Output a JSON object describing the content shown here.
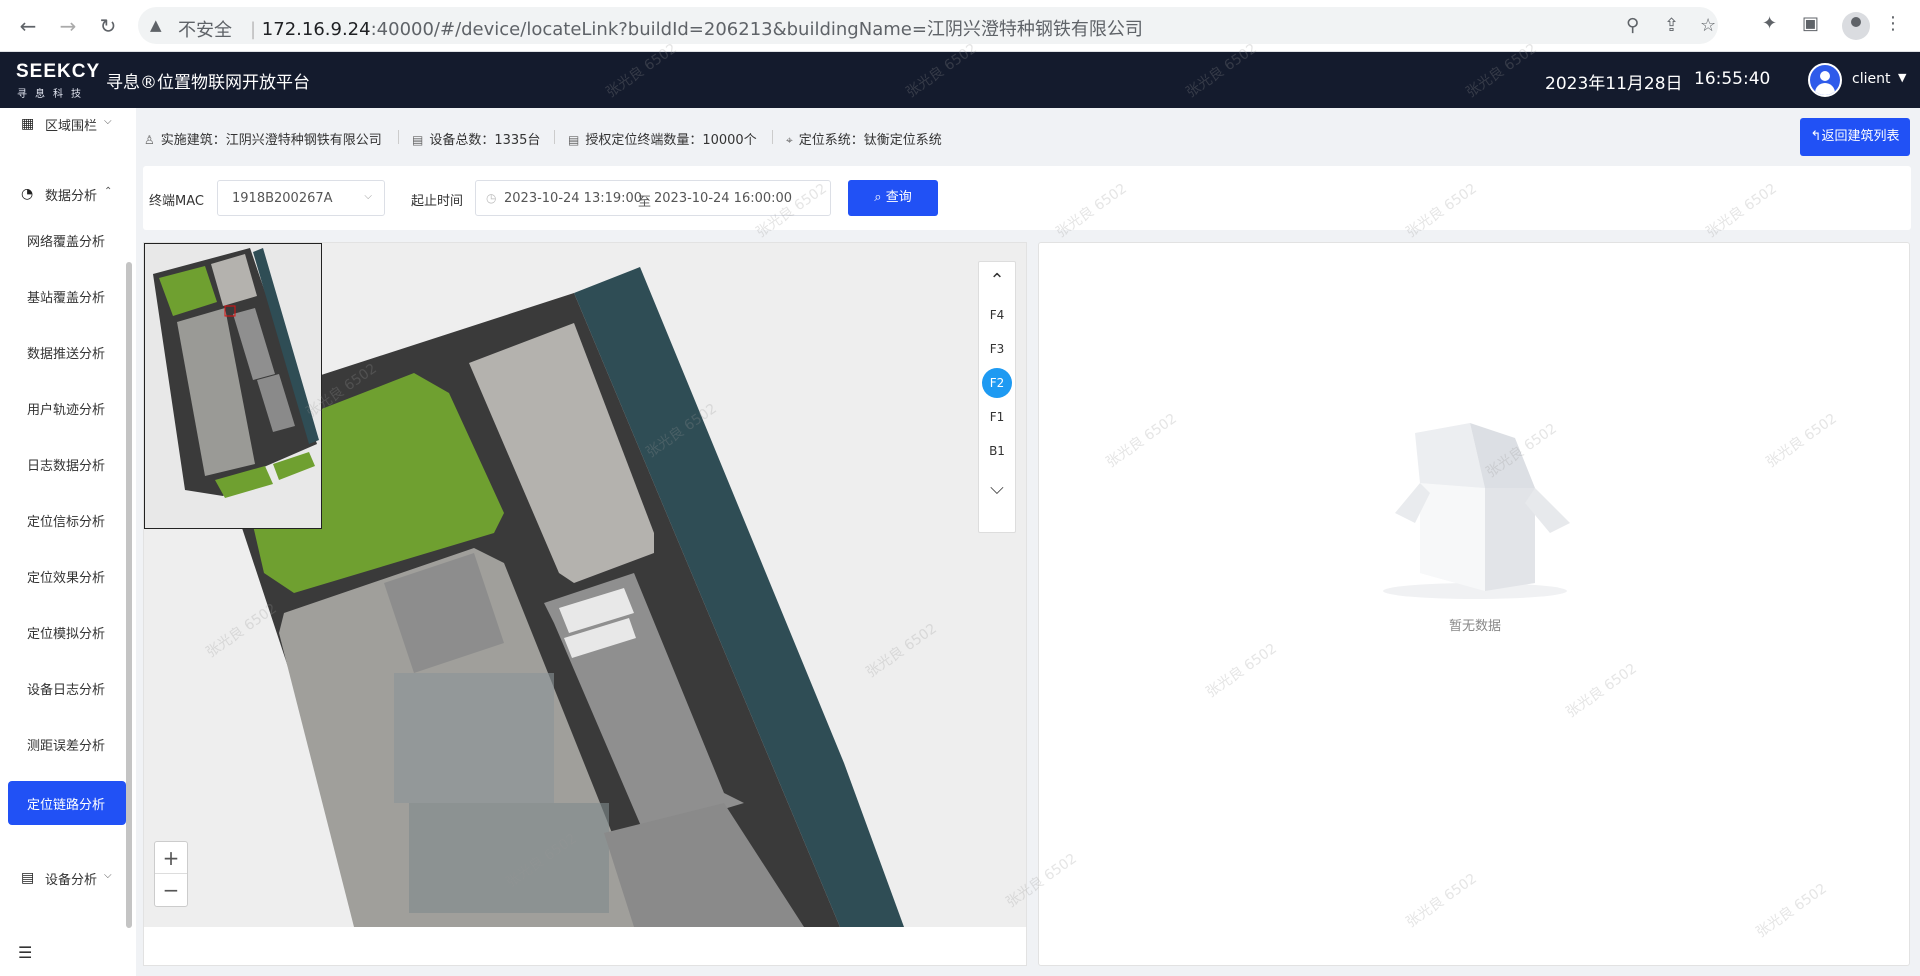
{
  "browser": {
    "insecure_label": "不安全",
    "url_host": "172.16.9.24",
    "url_rest": ":40000/#/device/locateLink?buildId=206213&buildingName=江阴兴澄特种钢铁有限公司"
  },
  "header": {
    "logo_main": "SEEKCY",
    "logo_sub": "寻息科技",
    "platform_name": "寻息®位置物联网开放平台",
    "date": "2023年11月28日",
    "time": "16:55:40",
    "username": "client"
  },
  "sidebar": {
    "groups": {
      "area_fence": "区域围栏",
      "data_analysis": "数据分析",
      "device_analysis": "设备分析"
    },
    "items": [
      "网络覆盖分析",
      "基站覆盖分析",
      "数据推送分析",
      "用户轨迹分析",
      "日志数据分析",
      "定位信标分析",
      "定位效果分析",
      "定位模拟分析",
      "设备日志分析",
      "测距误差分析",
      "定位链路分析"
    ],
    "active_item": "定位链路分析"
  },
  "info": {
    "building": "实施建筑：江阴兴澄特种钢铁有限公司",
    "device_total": "设备总数：1335台",
    "licensed_terminals": "授权定位终端数量：10000个",
    "location_system": "定位系统：钛衡定位系统",
    "return_button": "返回建筑列表"
  },
  "filter": {
    "mac_label": "终端MAC",
    "mac_value": "1918B200267A",
    "time_label": "起止时间",
    "start_time": "2023-10-24 13:19:00",
    "range_sep": "至",
    "end_time": "2023-10-24 16:00:00",
    "query_button": "查询"
  },
  "map": {
    "floors": [
      "F4",
      "F3",
      "F2",
      "F1",
      "B1"
    ],
    "selected_floor": "F2",
    "zoom_in": "+",
    "zoom_out": "−"
  },
  "result": {
    "empty_text": "暂无数据"
  },
  "watermark": "张光良 6502",
  "colors": {
    "header_bg": "#141b2d",
    "primary": "#2151f5",
    "floor_selected": "#1e9af2",
    "water": "#2f4d55",
    "grass": "#6fa030",
    "road": "#3a3a3a"
  }
}
